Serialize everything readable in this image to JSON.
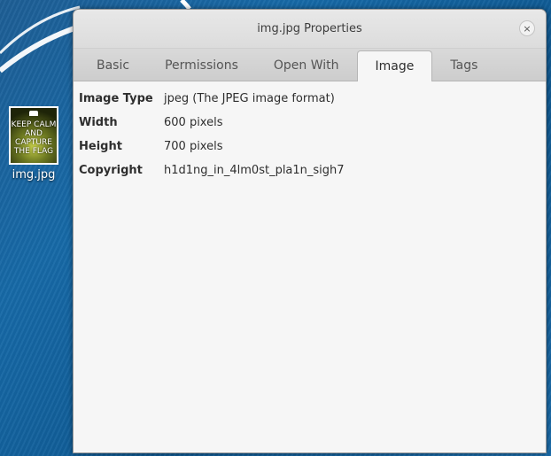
{
  "desktop": {
    "icon_label": "img.jpg",
    "thumbnail_text": "KEEP CALM AND CAPTURE THE FLAG"
  },
  "window": {
    "title": "img.jpg Properties",
    "close_glyph": "×",
    "tabs": [
      {
        "label": "Basic",
        "active": false
      },
      {
        "label": "Permissions",
        "active": false
      },
      {
        "label": "Open With",
        "active": false
      },
      {
        "label": "Image",
        "active": true
      },
      {
        "label": "Tags",
        "active": false
      }
    ],
    "properties": [
      {
        "key": "Image Type",
        "value": "jpeg (The JPEG image format)"
      },
      {
        "key": "Width",
        "value": "600 pixels"
      },
      {
        "key": "Height",
        "value": "700 pixels"
      },
      {
        "key": "Copyright",
        "value": "h1d1ng_in_4lm0st_pla1n_sigh7"
      }
    ]
  }
}
